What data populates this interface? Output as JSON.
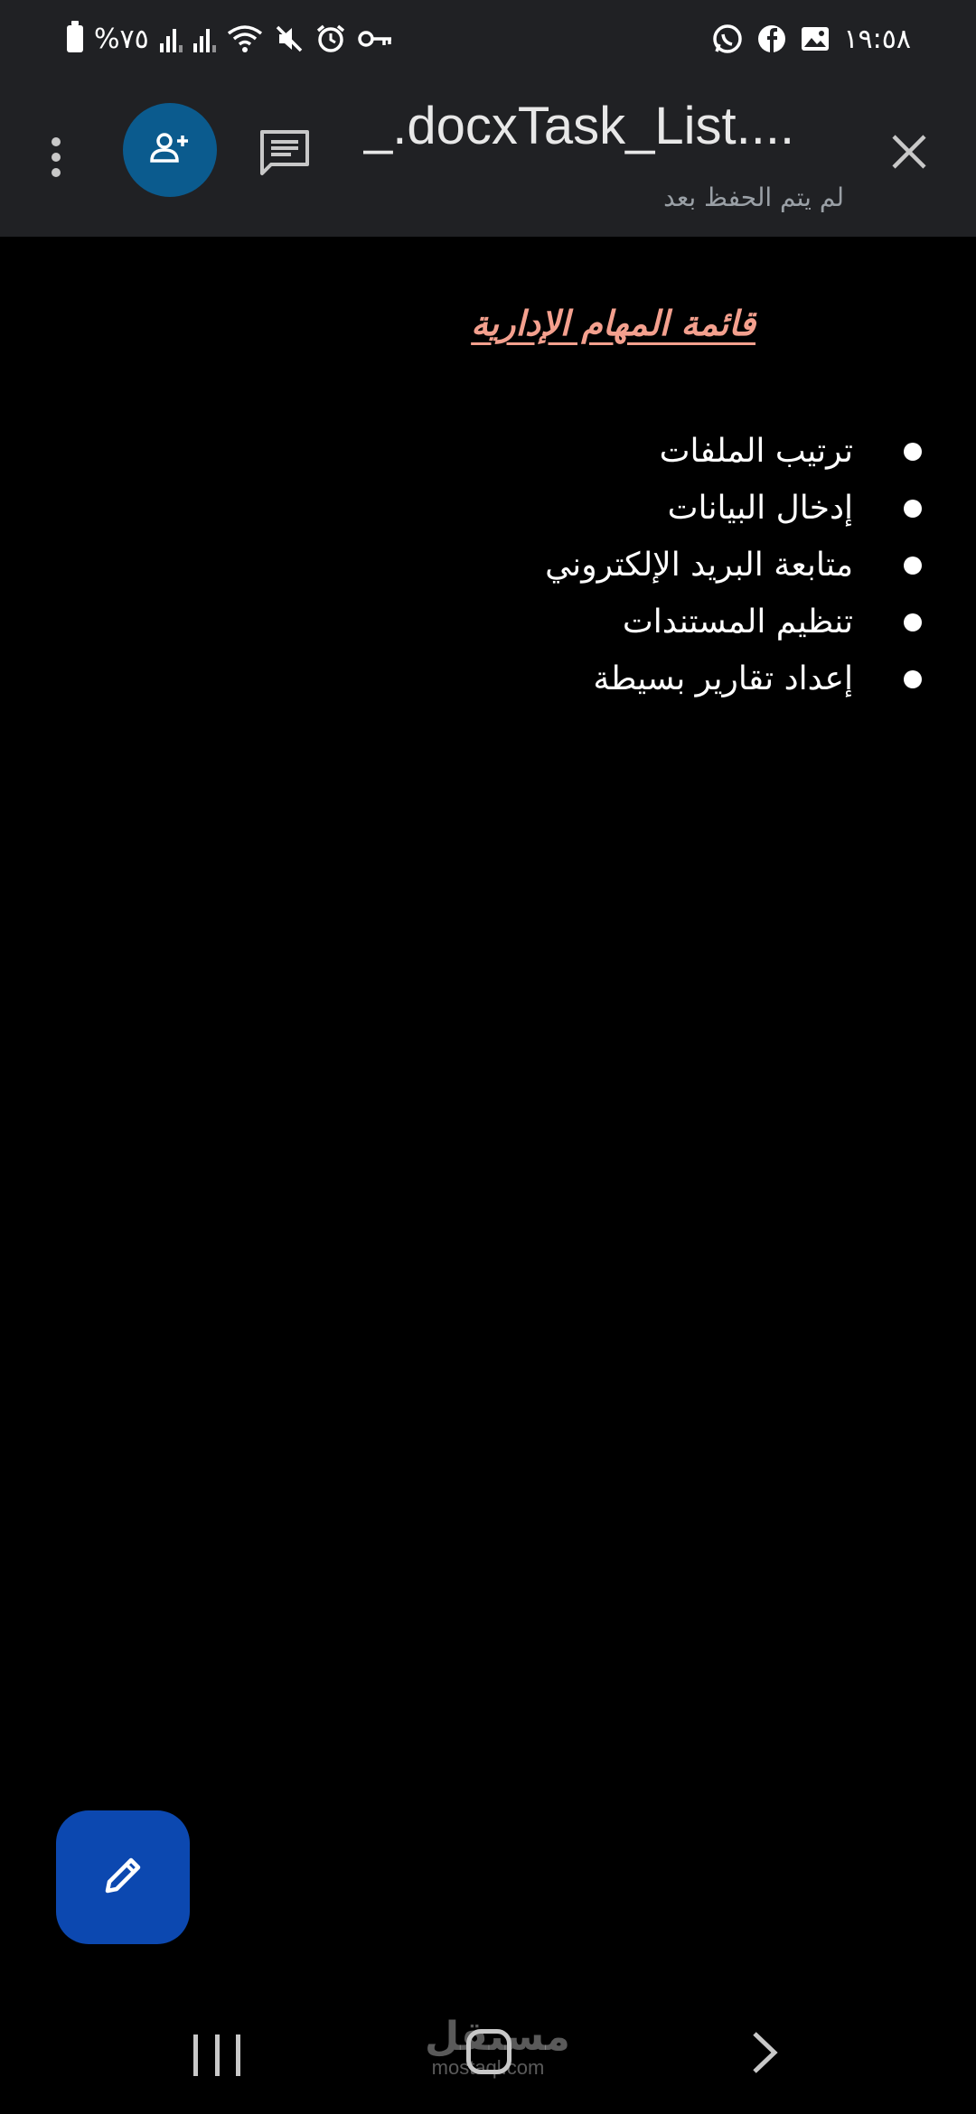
{
  "status_bar": {
    "battery": "%٧٥",
    "time": "١٩:٥٨",
    "icons_left": [
      "battery-icon",
      "signal-icon",
      "signal-icon",
      "wifi-icon",
      "mute-icon",
      "alarm-icon",
      "vpn-key-icon"
    ],
    "icons_right": [
      "whatsapp-icon",
      "facebook-icon",
      "gallery-icon"
    ]
  },
  "toolbar": {
    "title": "_.docxTask_List....",
    "status": "لم يتم الحفظ بعد",
    "accent_color": "#0b5b8e"
  },
  "document": {
    "heading": "قائمة المهام الإدارية",
    "heading_color": "#f4a08e",
    "tasks": [
      "ترتيب الملفات",
      "إدخال البيانات",
      "متابعة البريد الإلكتروني",
      "تنظيم المستندات",
      "إعداد تقارير بسيطة"
    ]
  },
  "fab": {
    "icon": "pencil-icon",
    "color": "#0c48b0"
  },
  "watermark": {
    "arabic": "مستقل",
    "latin": "mostaql.com"
  }
}
